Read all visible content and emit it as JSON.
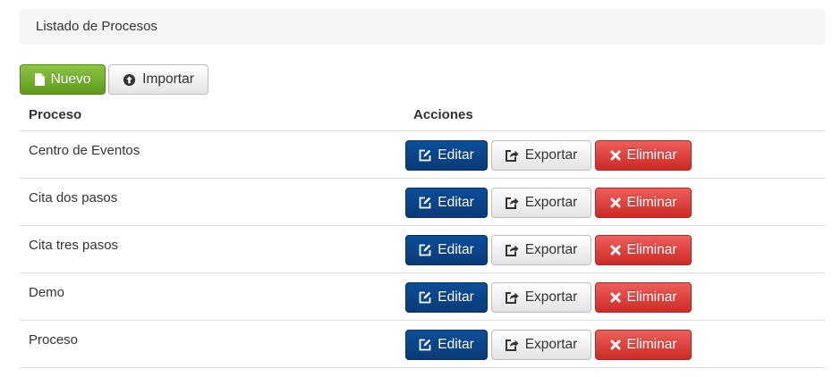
{
  "breadcrumb": {
    "title": "Listado de Procesos"
  },
  "toolbar": {
    "new_label": "Nuevo",
    "import_label": "Importar"
  },
  "table": {
    "headers": [
      "Proceso",
      "Acciones"
    ],
    "rows": [
      {
        "name": "Centro de Eventos"
      },
      {
        "name": "Cita dos pasos"
      },
      {
        "name": "Cita tres pasos"
      },
      {
        "name": "Demo"
      },
      {
        "name": "Proceso"
      }
    ],
    "actions": {
      "edit_label": "Editar",
      "export_label": "Exportar",
      "delete_label": "Eliminar"
    }
  },
  "icons": {
    "new": "file-icon",
    "import": "circle-arrow-up-icon",
    "edit": "edit-icon",
    "export": "share-icon",
    "delete": "x-icon"
  },
  "colors": {
    "new_button": "#6aab2a",
    "edit_button": "#0b458c",
    "delete_button": "#dd4440",
    "default_button": "#f0f0f0",
    "breadcrumb_bg": "#f5f5f5"
  }
}
